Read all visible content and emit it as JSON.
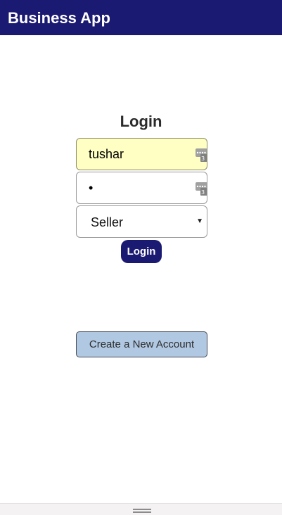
{
  "app": {
    "title": "Business App"
  },
  "login": {
    "heading": "Login",
    "username_value": "tushar",
    "password_value": "•",
    "role_selected": "Seller",
    "submit_label": "Login"
  },
  "register": {
    "label": "Create a New Account"
  },
  "icons": {
    "keyboard": "keyboard-icon",
    "caret": "chevron-down-icon",
    "handle": "drag-handle-icon"
  },
  "colors": {
    "app_bar": "#1b1a72",
    "autofill_bg": "#ffffc4",
    "create_button_bg": "#b1c8e2"
  }
}
